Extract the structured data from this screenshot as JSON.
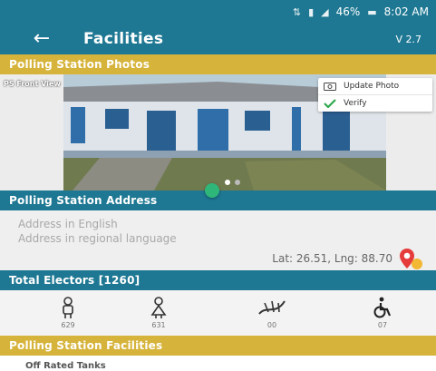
{
  "status_bar": {
    "battery": "46%",
    "time": "8:02 AM"
  },
  "app_bar": {
    "title": "Facilities",
    "version": "V 2.7",
    "back_icon": "arrow-left-icon"
  },
  "photos_section": {
    "header": "Polling Station Photos",
    "photo_label": "PS Front View",
    "actions": [
      {
        "label": "Update Photo",
        "icon": "camera-icon"
      },
      {
        "label": "Verify",
        "icon": "checkmark-icon"
      }
    ],
    "carousel_pages": 2,
    "active_page": 1
  },
  "address_section": {
    "header": "Polling Station Address",
    "english_placeholder": "Address in English",
    "regional_placeholder": "Address in regional language",
    "lat_lng": "Lat: 26.51, Lng: 88.70",
    "map_icon": "map-pin-icon"
  },
  "electors_section": {
    "header": "Total Electors [1260]",
    "items": [
      {
        "icon": "male-icon",
        "count": "629"
      },
      {
        "icon": "female-icon",
        "count": "631"
      },
      {
        "icon": "third-gender-icon",
        "count": "00"
      },
      {
        "icon": "wheelchair-icon",
        "count": "07"
      }
    ]
  },
  "facilities_section": {
    "header": "Polling Station Facilities",
    "first_item": "Off Rated Tanks"
  },
  "colors": {
    "primary": "#1e7893",
    "accent_gold": "#d6b33a",
    "fab_green": "#2fb77a",
    "pin_red": "#e63b3b"
  }
}
